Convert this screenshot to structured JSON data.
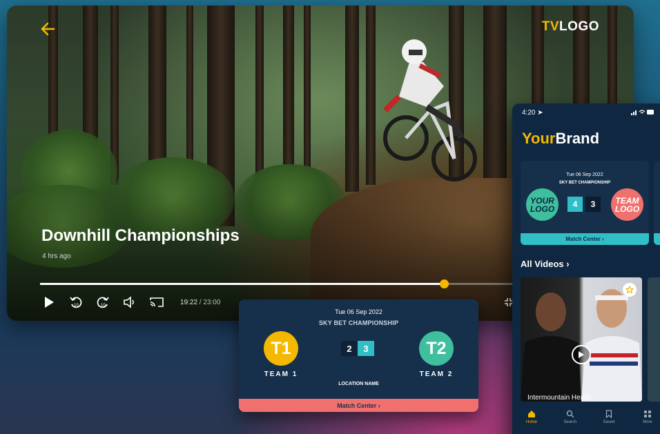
{
  "player": {
    "brand_prefix": "TV",
    "brand_suffix": "LOGO",
    "title": "Downhill Championships",
    "posted": "4 hrs ago",
    "elapsed": "19:22",
    "separator": " / ",
    "duration": "23:00",
    "progress_fraction": 0.68,
    "accent": "#f5b800"
  },
  "scorecard": {
    "date": "Tue 06 Sep 2022",
    "competition": "SKY BET CHAMPIONSHIP",
    "home_badge": "T1",
    "home_name": "TEAM 1",
    "home_color": "#f5b800",
    "away_badge": "T2",
    "away_name": "TEAM 2",
    "away_color": "#3fbf9e",
    "home_score": "2",
    "away_score": "3",
    "location": "LOCATION NAME",
    "cta": "Match Center ›",
    "cta_color": "#f0706e"
  },
  "phone": {
    "time": "4:20",
    "brand_your": "Your",
    "brand_rest": "Brand",
    "match": {
      "date": "Tue 06 Sep 2022",
      "competition": "SKY BET CHAMPIONSHIP",
      "home_line1": "YOUR",
      "home_line2": "LOGO",
      "home_color": "#3fbf9e",
      "away_line1": "TEAM",
      "away_line2": "LOGO",
      "away_color": "#f0706e",
      "home_score": "4",
      "away_score": "3",
      "cta": "Match Center ›"
    },
    "all_videos": "All Videos",
    "thumb_caption": "Intermountain Health",
    "tabs": [
      {
        "label": "Home",
        "icon": "home-icon"
      },
      {
        "label": "Search",
        "icon": "search-icon"
      },
      {
        "label": "Saved",
        "icon": "bookmark-icon"
      },
      {
        "label": "More",
        "icon": "grid-icon"
      }
    ]
  }
}
